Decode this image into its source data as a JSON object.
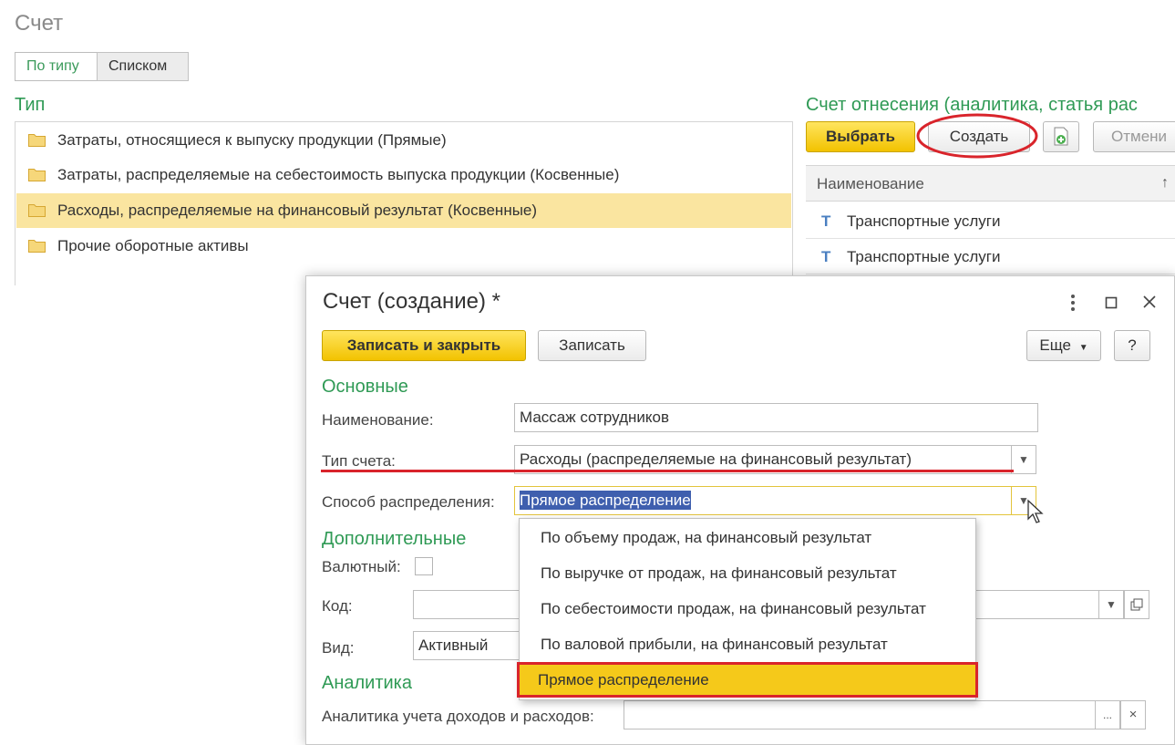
{
  "page": {
    "title": "Счет"
  },
  "tabs": [
    {
      "label": "По типу"
    },
    {
      "label": "Списком"
    }
  ],
  "type_section": {
    "title": "Тип",
    "items": [
      {
        "label": "Затраты, относящиеся к выпуску продукции (Прямые)"
      },
      {
        "label": "Затраты, распределяемые на себестоимость выпуска продукции (Косвенные)"
      },
      {
        "label": "Расходы, распределяемые на финансовый результат (Косвенные)"
      },
      {
        "label": "Прочие оборотные активы"
      }
    ]
  },
  "right_panel": {
    "title": "Счет отнесения (аналитика, статья рас",
    "select_label": "Выбрать",
    "create_label": "Создать",
    "cancel_label": "Отмени",
    "column_header": "Наименование",
    "sort_arrow": "↑",
    "rows": [
      {
        "label": "Транспортные услуги"
      },
      {
        "label": "Транспортные услуги"
      }
    ]
  },
  "dialog": {
    "title": "Счет (создание) *",
    "save_close_label": "Записать и закрыть",
    "save_label": "Записать",
    "more_label": "Еще",
    "help_label": "?",
    "main_section": "Основные",
    "name_label": "Наименование:",
    "name_value": "Массаж сотрудников",
    "account_type_label": "Тип счета:",
    "account_type_value": "Расходы (распределяемые на финансовый результат)",
    "distribution_label": "Способ распределения:",
    "distribution_value": "Прямое распределение",
    "extra_section": "Дополнительные",
    "currency_label": "Валютный:",
    "code_label": "Код:",
    "kind_label": "Вид:",
    "kind_value": "Активный",
    "analytics_section": "Аналитика",
    "analytics_label": "Аналитика учета доходов и расходов:",
    "ellipsis": "...",
    "clear": "×"
  },
  "dropdown": {
    "options": [
      {
        "label": "По объему продаж, на финансовый результат"
      },
      {
        "label": "По выручке от продаж, на финансовый результат"
      },
      {
        "label": "По себестоимости продаж, на финансовый результат"
      },
      {
        "label": "По валовой прибыли, на финансовый результат"
      },
      {
        "label": "Прямое распределение"
      }
    ],
    "selected_index": 4
  },
  "colors": {
    "accent_green": "#2f9a55",
    "selection_yellow": "#fae5a0",
    "button_yellow": "#f2c200",
    "annotation_red": "#d9242b"
  }
}
